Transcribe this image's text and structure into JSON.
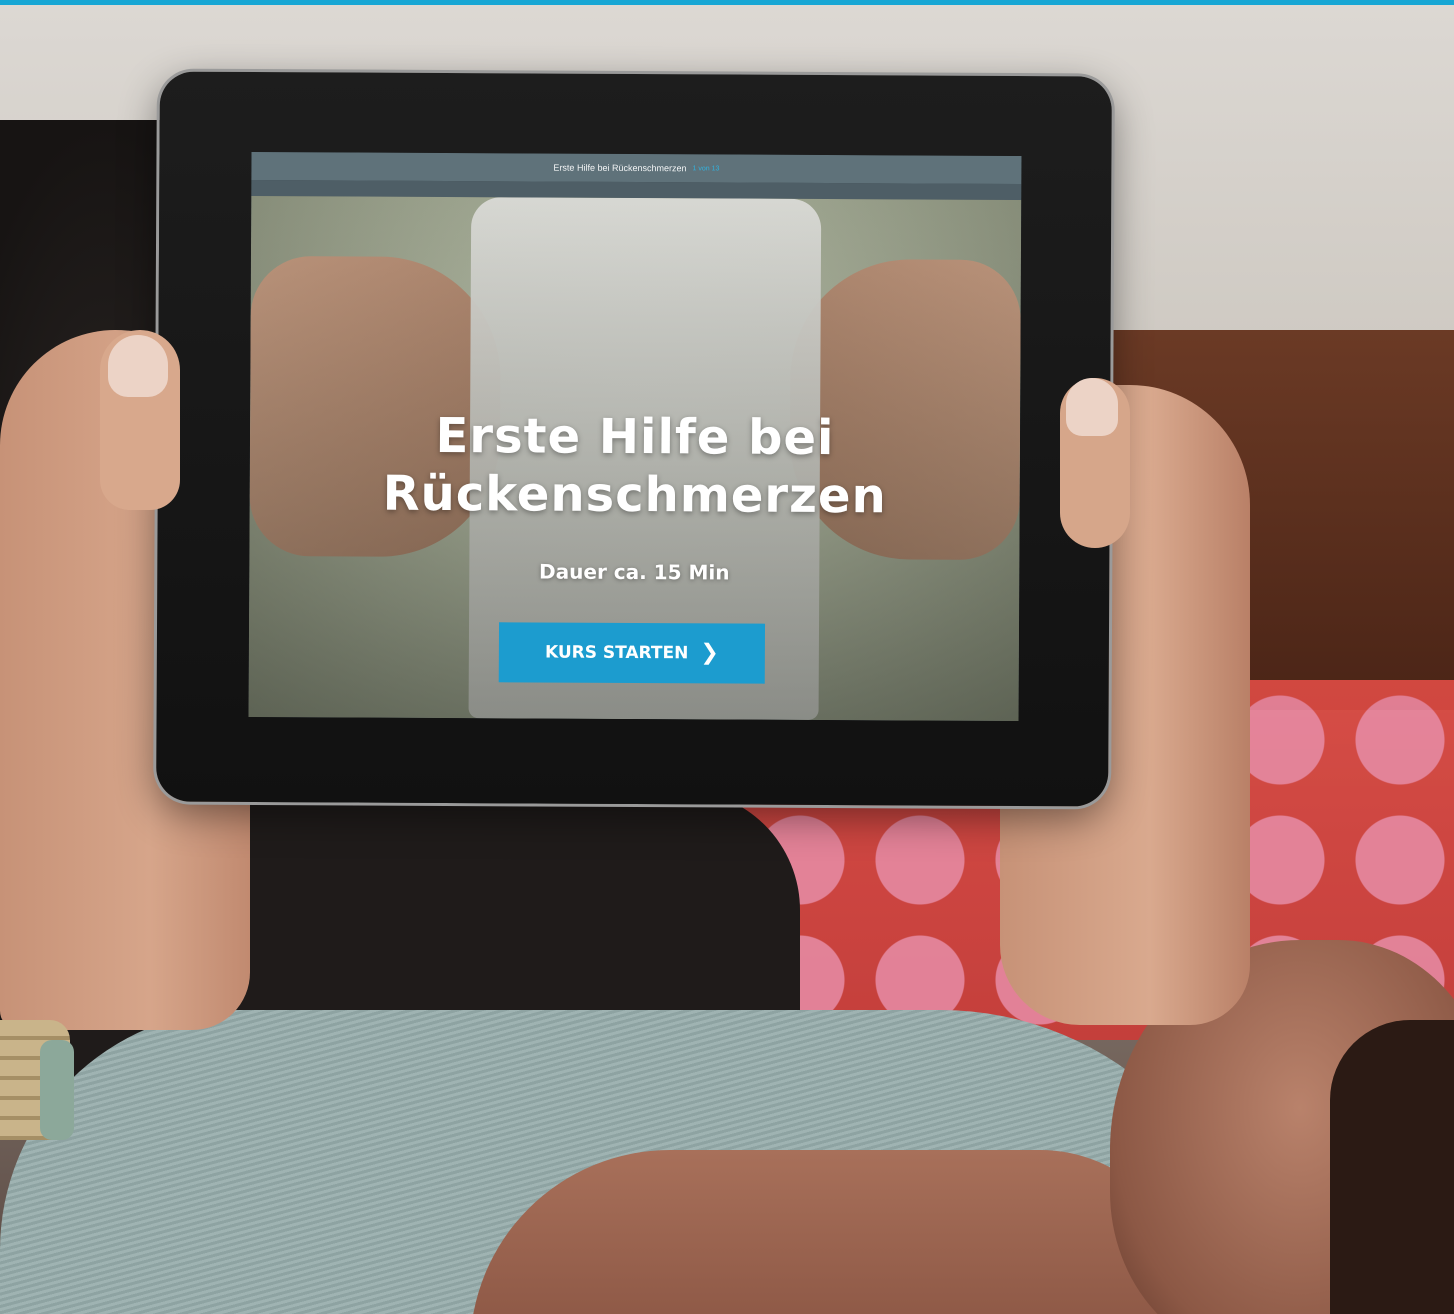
{
  "app": {
    "header_title": "Erste Hilfe bei Rückenschmerzen",
    "header_counter": "1 von 13"
  },
  "hero": {
    "title": "Erste Hilfe bei Rückenschmerzen",
    "duration": "Dauer ca. 15 Min",
    "cta_label": "KURS STARTEN",
    "cta_icon": "chevron-right-icon"
  },
  "colors": {
    "accent": "#1c9ccf",
    "top_stripe": "#17a6d4",
    "header_bar": "#5f727a"
  }
}
